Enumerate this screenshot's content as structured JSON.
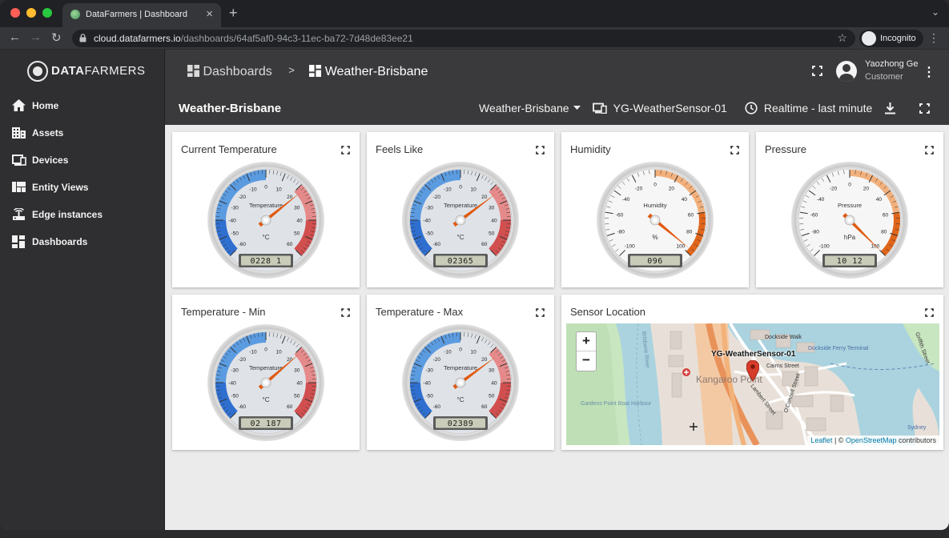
{
  "browser": {
    "tab_title": "DataFarmers | Dashboard",
    "url_host": "cloud.datafarmers.io",
    "url_path": "/dashboards/64af5af0-94c3-11ec-ba72-7d48de83ee21",
    "profile_label": "Incognito"
  },
  "brand": {
    "logo_bold": "DATA",
    "logo_rest": "FARMERS"
  },
  "sidebar": {
    "items": [
      {
        "label": "Home",
        "icon": "home-icon"
      },
      {
        "label": "Assets",
        "icon": "assets-icon"
      },
      {
        "label": "Devices",
        "icon": "devices-icon"
      },
      {
        "label": "Entity Views",
        "icon": "entity-views-icon"
      },
      {
        "label": "Edge instances",
        "icon": "edge-icon"
      },
      {
        "label": "Dashboards",
        "icon": "dashboards-icon"
      }
    ]
  },
  "breadcrumb": {
    "root": "Dashboards",
    "separator": ">",
    "current": "Weather-Brisbane"
  },
  "user": {
    "name": "Yaozhong Ge",
    "role": "Customer"
  },
  "toolbar": {
    "title": "Weather-Brisbane",
    "state_select": "Weather-Brisbane",
    "entity": "YG-WeatherSensor-01",
    "timewindow": "Realtime - last minute"
  },
  "widgets": [
    {
      "title": "Current Temperature",
      "label": "Temperature",
      "unit": "°C",
      "display": "0228 1",
      "value": 22.81,
      "min": -60,
      "max": 60,
      "ticks": [
        "-60",
        "-50",
        "-40",
        "-30",
        "-20",
        "-10",
        "0",
        "10",
        "20",
        "30",
        "40",
        "50",
        "60"
      ]
    },
    {
      "title": "Feels Like",
      "label": "Temperature",
      "unit": "°C",
      "display": "02365",
      "value": 23.65,
      "min": -60,
      "max": 60,
      "ticks": [
        "-60",
        "-50",
        "-40",
        "-30",
        "-20",
        "-10",
        "0",
        "10",
        "20",
        "30",
        "40",
        "50",
        "60"
      ]
    },
    {
      "title": "Humidity",
      "label": "Humidity",
      "unit": "%",
      "display": "096",
      "value": 96,
      "min": -100,
      "max": 100,
      "ticks": [
        "-100",
        "-80",
        "-60",
        "-40",
        "-20",
        "0",
        "20",
        "40",
        "60",
        "80",
        "100"
      ]
    },
    {
      "title": "Pressure",
      "label": "Pressure",
      "unit": "hPa",
      "display": "10 12",
      "value": 1012,
      "min": -100,
      "max": 100,
      "ticks": [
        "-100",
        "-80",
        "-60",
        "-40",
        "-20",
        "0",
        "20",
        "40",
        "60",
        "80",
        "100"
      ]
    },
    {
      "title": "Temperature - Min",
      "label": "Temperature",
      "unit": "°C",
      "display": "02 187",
      "value": 21.87,
      "min": -60,
      "max": 60,
      "ticks": [
        "-60",
        "-50",
        "-40",
        "-30",
        "-20",
        "-10",
        "0",
        "10",
        "20",
        "30",
        "40",
        "50",
        "60"
      ]
    },
    {
      "title": "Temperature - Max",
      "label": "Temperature",
      "unit": "°C",
      "display": "02389",
      "value": 23.89,
      "min": -60,
      "max": 60,
      "ticks": [
        "-60",
        "-50",
        "-40",
        "-30",
        "-20",
        "-10",
        "0",
        "10",
        "20",
        "30",
        "40",
        "50",
        "60"
      ]
    }
  ],
  "map": {
    "title": "Sensor Location",
    "marker_label": "YG-WeatherSensor-01",
    "zoom_in": "+",
    "zoom_out": "−",
    "attribution_leaflet": "Leaflet",
    "attribution_sep": " | © ",
    "attribution_osm": "OpenStreetMap",
    "attribution_tail": " contributors",
    "place_labels": [
      "Kangaroo Point",
      "Dockside Walk",
      "Dockside Ferry Terminal",
      "Cairns Street",
      "O'Connell Street",
      "Lambert Street",
      "Brisbane River",
      "Gardens Point Boat Harbour",
      "Sydney",
      "Griffith Street"
    ]
  },
  "colors": {
    "accent_orange": "#e05a10",
    "cold_blue": "#2f7fd8",
    "hot_red": "#d14040"
  }
}
